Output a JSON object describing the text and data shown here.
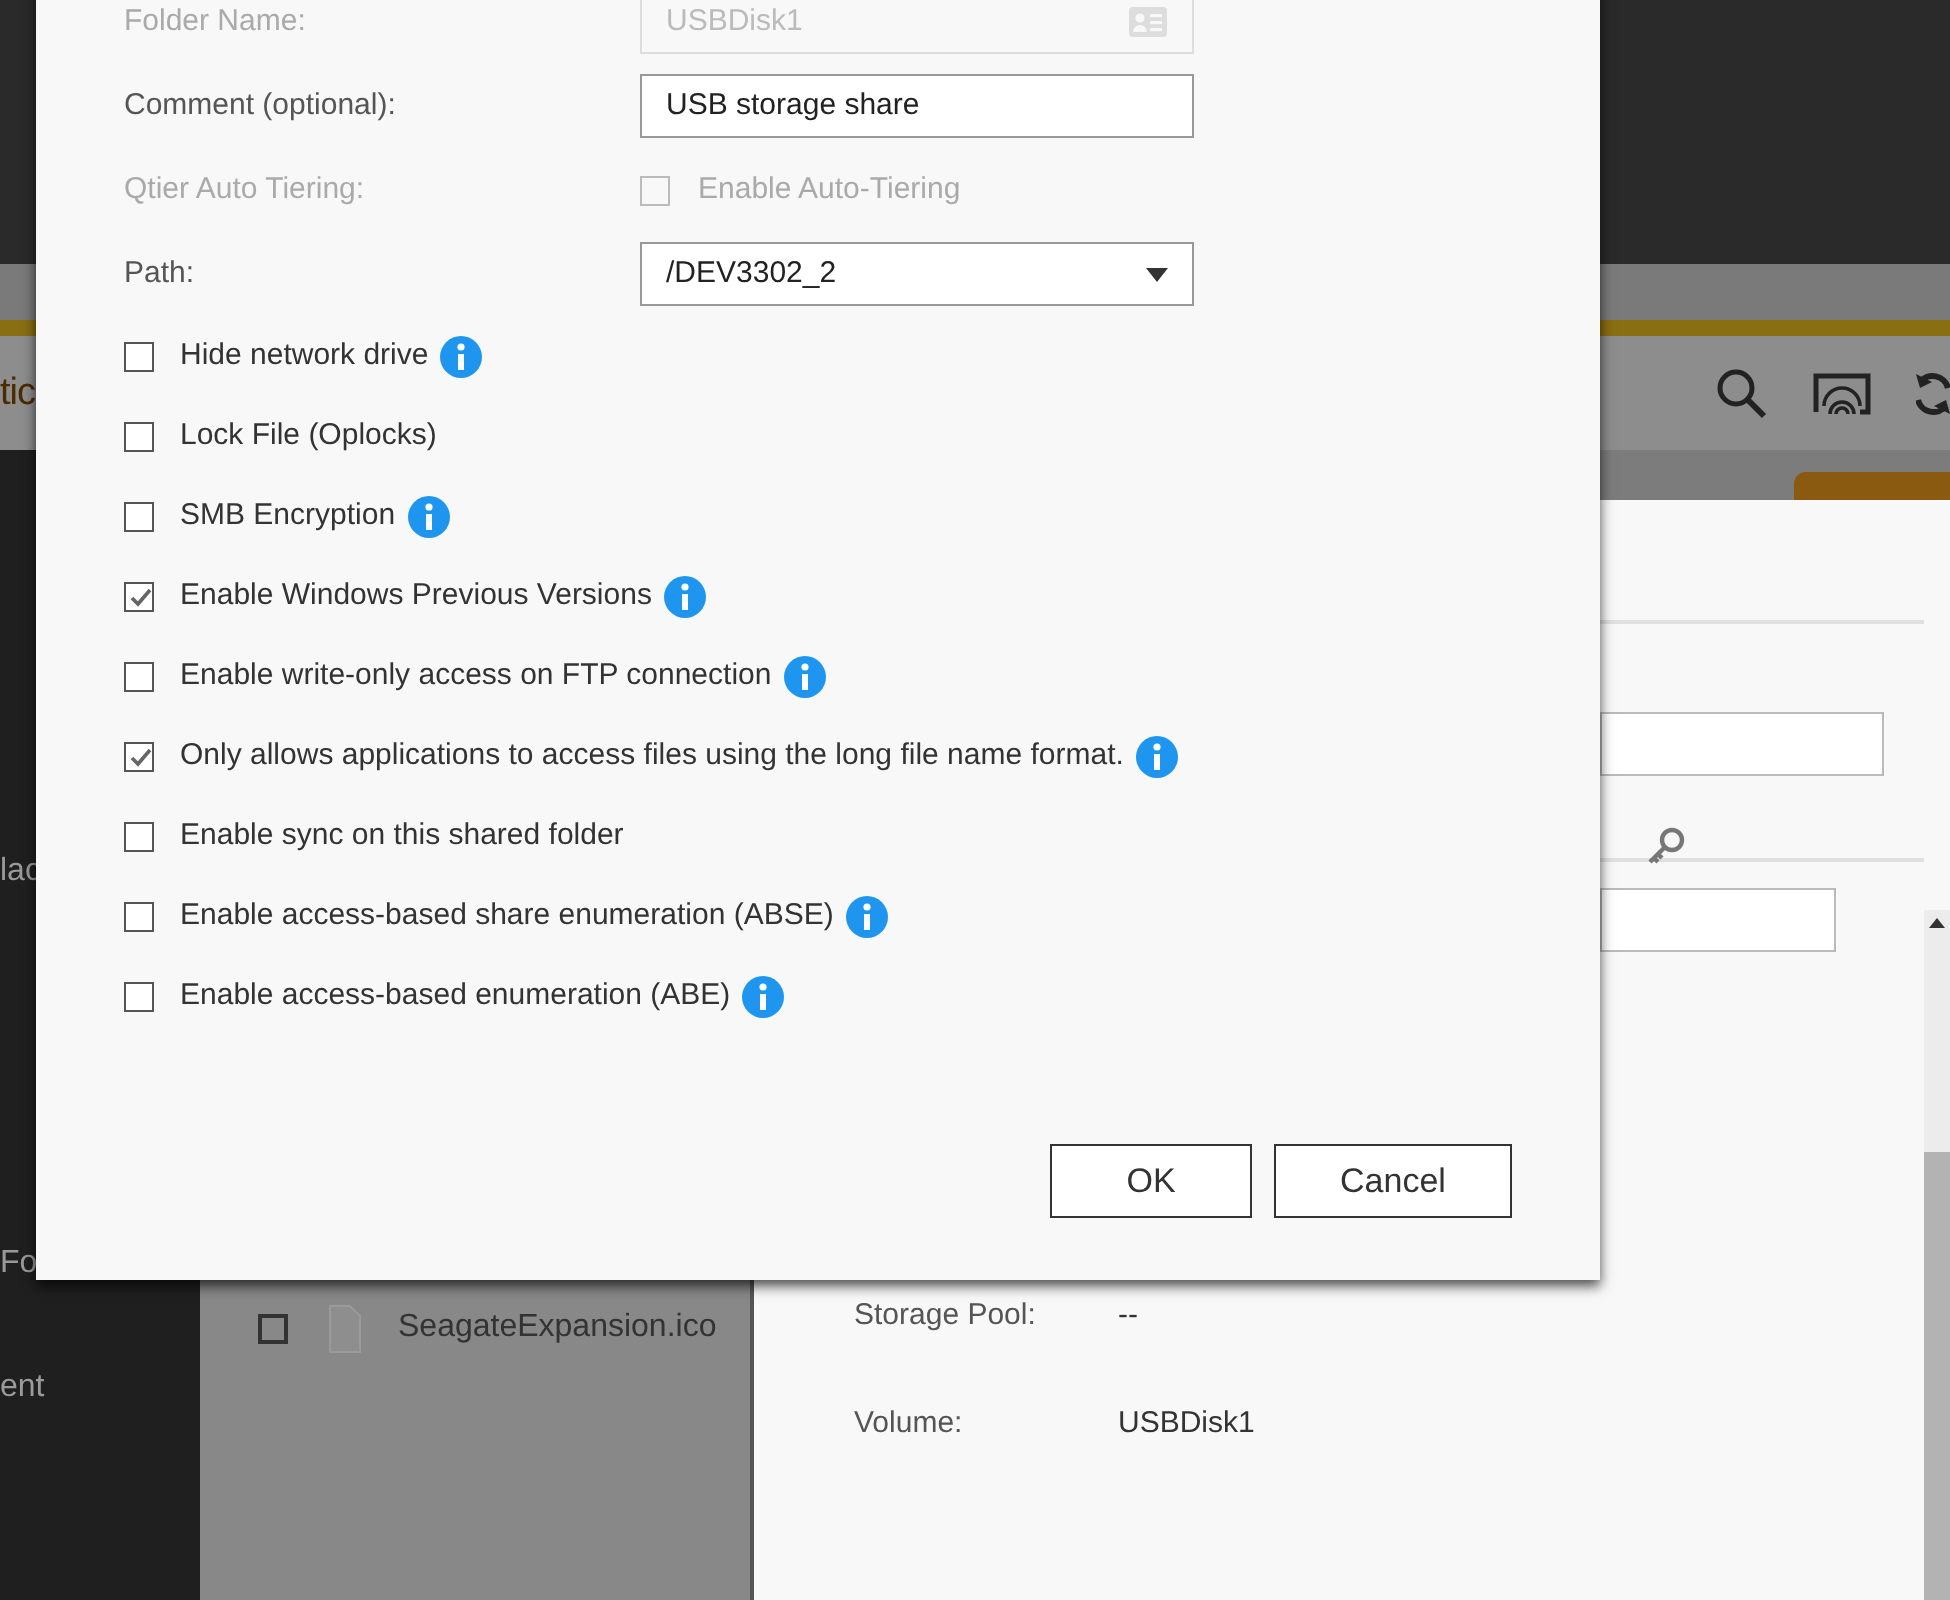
{
  "background": {
    "header_title": "tic",
    "sidebar": {
      "items": [
        "lac",
        "Fo",
        "ent"
      ]
    },
    "file_list": {
      "rows": [
        {
          "name": "SeagateExpansion.ico",
          "checked": false
        }
      ]
    },
    "details": {
      "fields": [
        {
          "label": "Storage Pool:",
          "value": "--"
        },
        {
          "label": "Volume:",
          "value": "USBDisk1"
        }
      ]
    }
  },
  "dialog": {
    "fields": [
      {
        "kind": "text",
        "label": "Folder Name:",
        "value": "USBDisk1",
        "disabled": true
      },
      {
        "kind": "text",
        "label": "Comment (optional):",
        "value": "USB storage share",
        "disabled": false
      },
      {
        "kind": "checkbox",
        "label": "Qtier Auto Tiering:",
        "option": "Enable Auto-Tiering",
        "checked": false,
        "disabled": true
      },
      {
        "kind": "select",
        "label": "Path:",
        "value": "/DEV3302_2",
        "disabled": false
      }
    ],
    "options": [
      {
        "label": "Hide network drive",
        "checked": false,
        "info": true
      },
      {
        "label": "Lock File (Oplocks)",
        "checked": false,
        "info": false
      },
      {
        "label": "SMB Encryption",
        "checked": false,
        "info": true
      },
      {
        "label": "Enable Windows Previous Versions",
        "checked": true,
        "info": true
      },
      {
        "label": "Enable write-only access on FTP connection",
        "checked": false,
        "info": true
      },
      {
        "label": "Only allows applications to access files using the long file name format.",
        "checked": true,
        "info": true
      },
      {
        "label": "Enable sync on this shared folder",
        "checked": false,
        "info": false
      },
      {
        "label": "Enable access-based share enumeration (ABSE)",
        "checked": false,
        "info": true
      },
      {
        "label": "Enable access-based enumeration (ABE)",
        "checked": false,
        "info": true
      }
    ],
    "buttons": [
      "OK",
      "Cancel"
    ]
  }
}
